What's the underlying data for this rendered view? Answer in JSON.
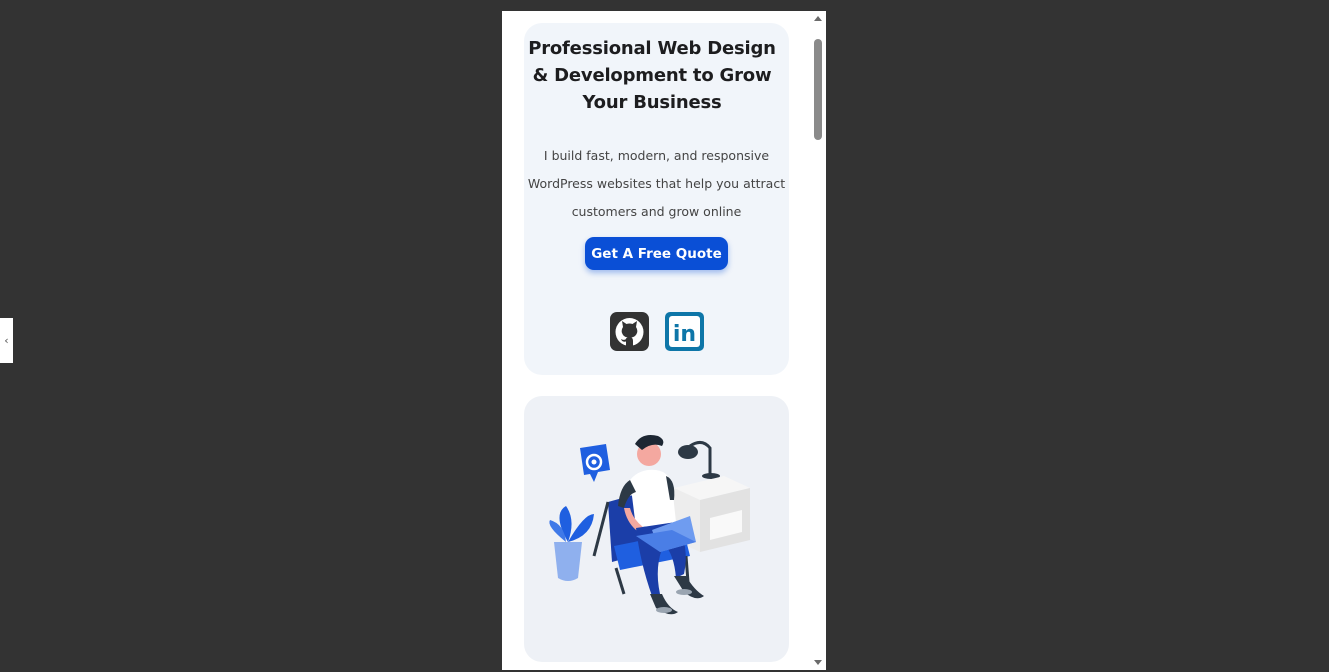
{
  "hero": {
    "title_line1": "Professional Web Design",
    "title_line2": "& Development to Grow",
    "title_line3": "Your Business",
    "desc_line1": "I build fast, modern, and responsive",
    "desc_line2": "WordPress websites that help you attract",
    "desc_line3": "customers and grow online",
    "cta_label": "Get A Free Quote"
  },
  "social": {
    "github_icon": "github-icon",
    "linkedin_icon": "linkedin-icon",
    "linkedin_label": "in"
  },
  "illustration": {
    "name": "person-working-on-laptop-illustration"
  },
  "colors": {
    "page_bg": "#333333",
    "card_bg": "#f1f5fa",
    "accent": "#0a4fd6",
    "title": "#1d1d1f",
    "github": "#333333",
    "linkedin": "#0e76a8"
  }
}
